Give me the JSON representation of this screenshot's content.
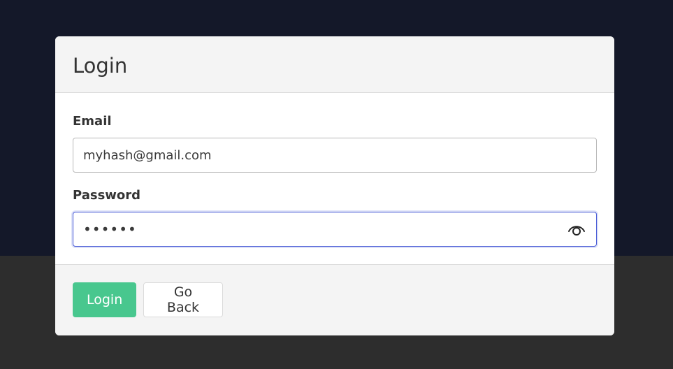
{
  "card": {
    "title": "Login"
  },
  "form": {
    "email": {
      "label": "Email",
      "value": "myhash@gmail.com"
    },
    "password": {
      "label": "Password",
      "value": "••••••",
      "toggle_icon": "eye-icon"
    }
  },
  "footer": {
    "login_label": "Login",
    "back_label": "Go Back"
  },
  "colors": {
    "background_top": "#141829",
    "background_bottom": "#2d2d2d",
    "primary": "#48c78e",
    "focus": "#4a5cd6"
  }
}
